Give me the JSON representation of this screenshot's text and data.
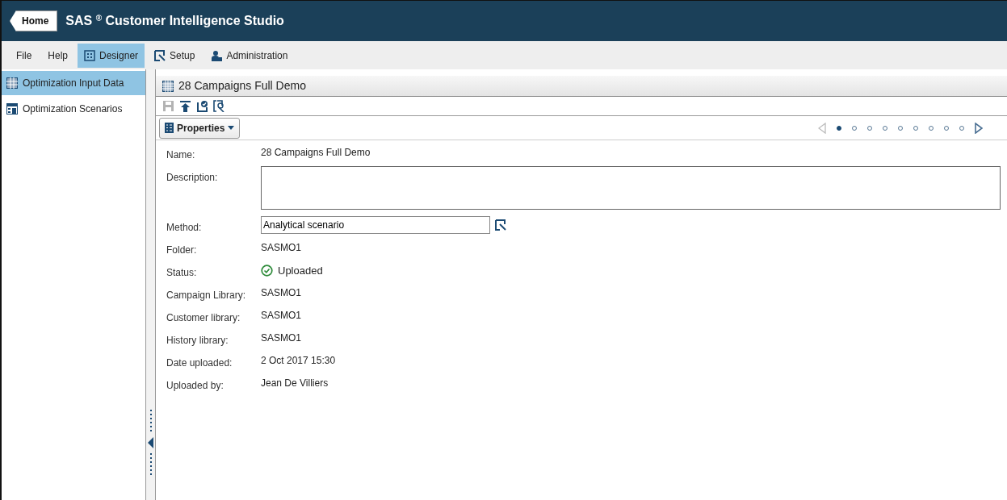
{
  "header": {
    "home_button": "Home",
    "title": "SAS",
    "title_mark": "®",
    "title_rest": "Customer Intelligence Studio"
  },
  "menu": [
    {
      "label": "File",
      "kind": "plain",
      "selected": false
    },
    {
      "label": "Help",
      "kind": "plain",
      "selected": false
    },
    {
      "label": "Designer",
      "kind": "designer",
      "selected": true
    },
    {
      "label": "Setup",
      "kind": "setup",
      "selected": false
    },
    {
      "label": "Administration",
      "kind": "admin",
      "selected": false
    }
  ],
  "sidebar": {
    "items": [
      {
        "label": "Optimization Input Data",
        "kind": "data",
        "selected": true
      },
      {
        "label": "Optimization Scenarios",
        "kind": "scenarios",
        "selected": false
      }
    ]
  },
  "panel": {
    "title": "28 Campaigns Full Demo",
    "toolbar": [
      {
        "kind": "save",
        "disabled": true
      },
      {
        "kind": "upload",
        "disabled": false
      },
      {
        "kind": "check",
        "disabled": false
      },
      {
        "kind": "open",
        "disabled": false
      }
    ],
    "properties_button": "Properties",
    "pager": [
      {
        "selected": true
      },
      {
        "selected": false
      },
      {
        "selected": false
      },
      {
        "selected": false
      },
      {
        "selected": false
      },
      {
        "selected": false
      },
      {
        "selected": false
      },
      {
        "selected": false
      },
      {
        "selected": false
      }
    ],
    "fields": [
      {
        "label": "Name:",
        "kind": "text",
        "value": "28 Campaigns Full Demo"
      },
      {
        "label": "Description:",
        "kind": "textarea"
      },
      {
        "label": "Method:",
        "kind": "input",
        "value": "Analytical scenario"
      },
      {
        "label": "Folder:",
        "kind": "text",
        "value": "SASMO1"
      },
      {
        "label": "Status:",
        "kind": "status",
        "value": "Uploaded"
      },
      {
        "label": "Campaign Library:",
        "kind": "text",
        "value": "SASMO1"
      },
      {
        "label": "Customer library:",
        "kind": "text",
        "value": "SASMO1"
      },
      {
        "label": "History library:",
        "kind": "text",
        "value": "SASMO1"
      },
      {
        "label": "Date uploaded:",
        "kind": "text",
        "value": "2 Oct 2017 15:30"
      },
      {
        "label": "Uploaded by:",
        "kind": "text",
        "value": "Jean De Villiers"
      }
    ]
  }
}
